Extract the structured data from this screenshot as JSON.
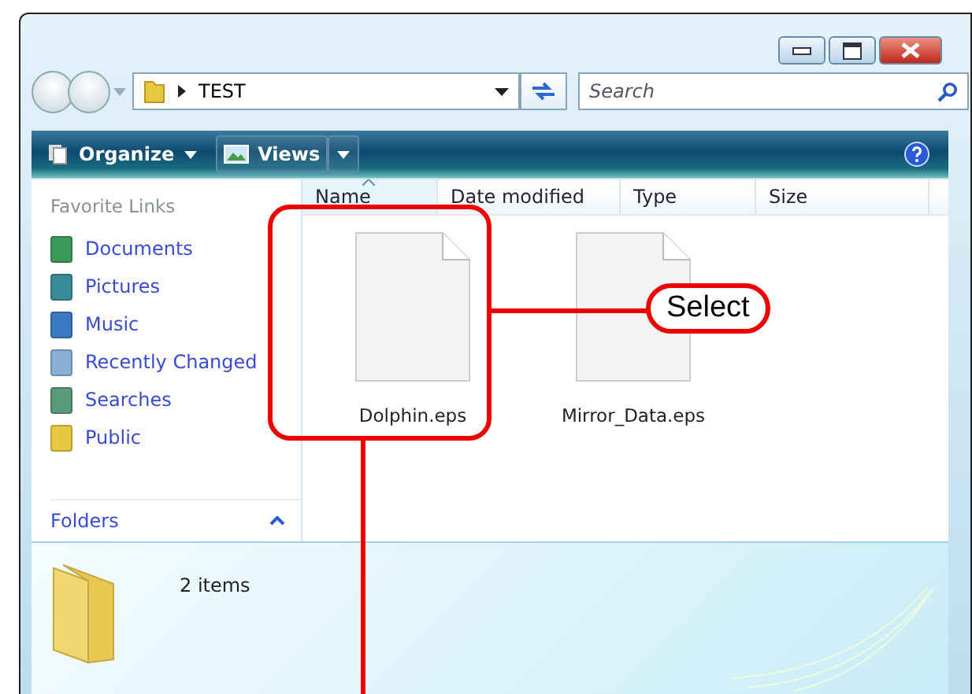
{
  "address": {
    "path": "TEST"
  },
  "search": {
    "placeholder": "Search"
  },
  "toolbar": {
    "buttons": [
      {
        "label": "Organize",
        "kind": "menu"
      },
      {
        "label": "Views",
        "kind": "split"
      }
    ]
  },
  "sidebar": {
    "heading": "Favorite Links",
    "links": [
      {
        "label": "Documents",
        "kind": "documents"
      },
      {
        "label": "Pictures",
        "kind": "pictures"
      },
      {
        "label": "Music",
        "kind": "music"
      },
      {
        "label": "Recently Changed",
        "kind": "recent"
      },
      {
        "label": "Searches",
        "kind": "searches"
      },
      {
        "label": "Public",
        "kind": "folder"
      }
    ],
    "folders_label": "Folders"
  },
  "columns": [
    {
      "label": "Name",
      "sorted": true
    },
    {
      "label": "Date modified",
      "sorted": false
    },
    {
      "label": "Type",
      "sorted": false
    },
    {
      "label": "Size",
      "sorted": false
    }
  ],
  "files": [
    {
      "name": "Dolphin.eps"
    },
    {
      "name": "Mirror_Data.eps"
    }
  ],
  "details": {
    "count": "2 items"
  },
  "annotation": {
    "label": "Select"
  }
}
